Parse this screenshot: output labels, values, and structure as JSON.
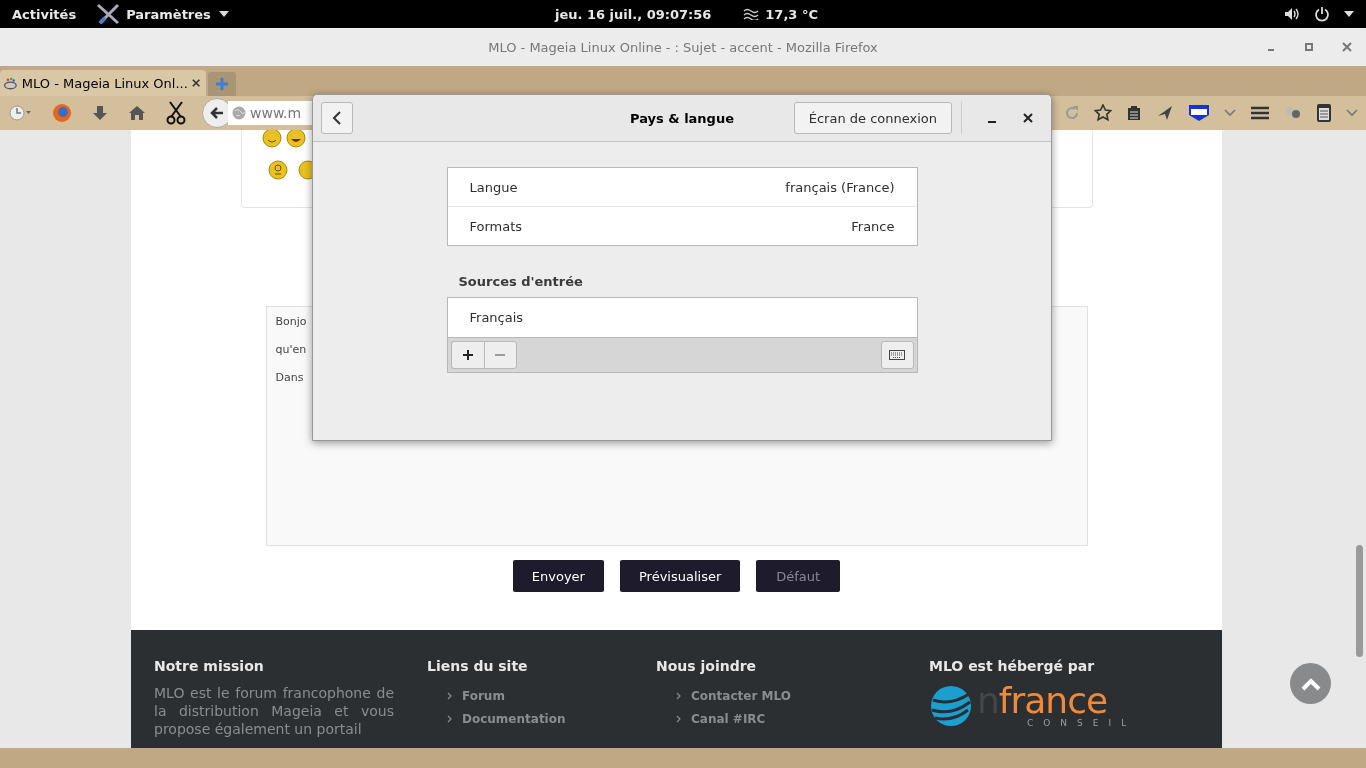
{
  "top_bar": {
    "activities": "Activités",
    "app_menu": "Paramètres",
    "clock": "jeu. 16 juil., 09:07:56",
    "weather": "17,3 °C"
  },
  "browser": {
    "title": "MLO - Mageia Linux Online - : Sujet - accent - Mozilla Firefox",
    "tabs": [
      {
        "label": "MLO - Mageia Linux Onl...",
        "selected": true
      }
    ],
    "url": "www.m"
  },
  "page": {
    "textarea_lines": [
      "Bonjo",
      "qu'en",
      "Dans"
    ],
    "buttons": [
      {
        "label": "Envoyer",
        "disabled": false
      },
      {
        "label": "Prévisualiser",
        "disabled": false
      },
      {
        "label": "Défaut",
        "disabled": true
      }
    ],
    "footer": [
      {
        "heading": "Notre mission",
        "text": "MLO est le forum francophone de la distribution Mageia et vous propose également un portail"
      },
      {
        "heading": "Liens du site",
        "links": [
          "Forum",
          "Documentation"
        ]
      },
      {
        "heading": "Nous joindre",
        "links": [
          "Contacter MLO",
          "Canal #IRC"
        ]
      },
      {
        "heading": "MLO est hébergé par",
        "logo": {
          "name_dark": "n",
          "name": "france",
          "tagline": "CONSEIL"
        }
      }
    ]
  },
  "dialog": {
    "title": "Pays & langue",
    "login_button": "Écran de connexion",
    "rows": [
      {
        "label": "Langue",
        "value": "français (France)"
      },
      {
        "label": "Formats",
        "value": "France"
      }
    ],
    "sources_heading": "Sources d'entrée",
    "sources": [
      {
        "label": "Français"
      }
    ]
  }
}
